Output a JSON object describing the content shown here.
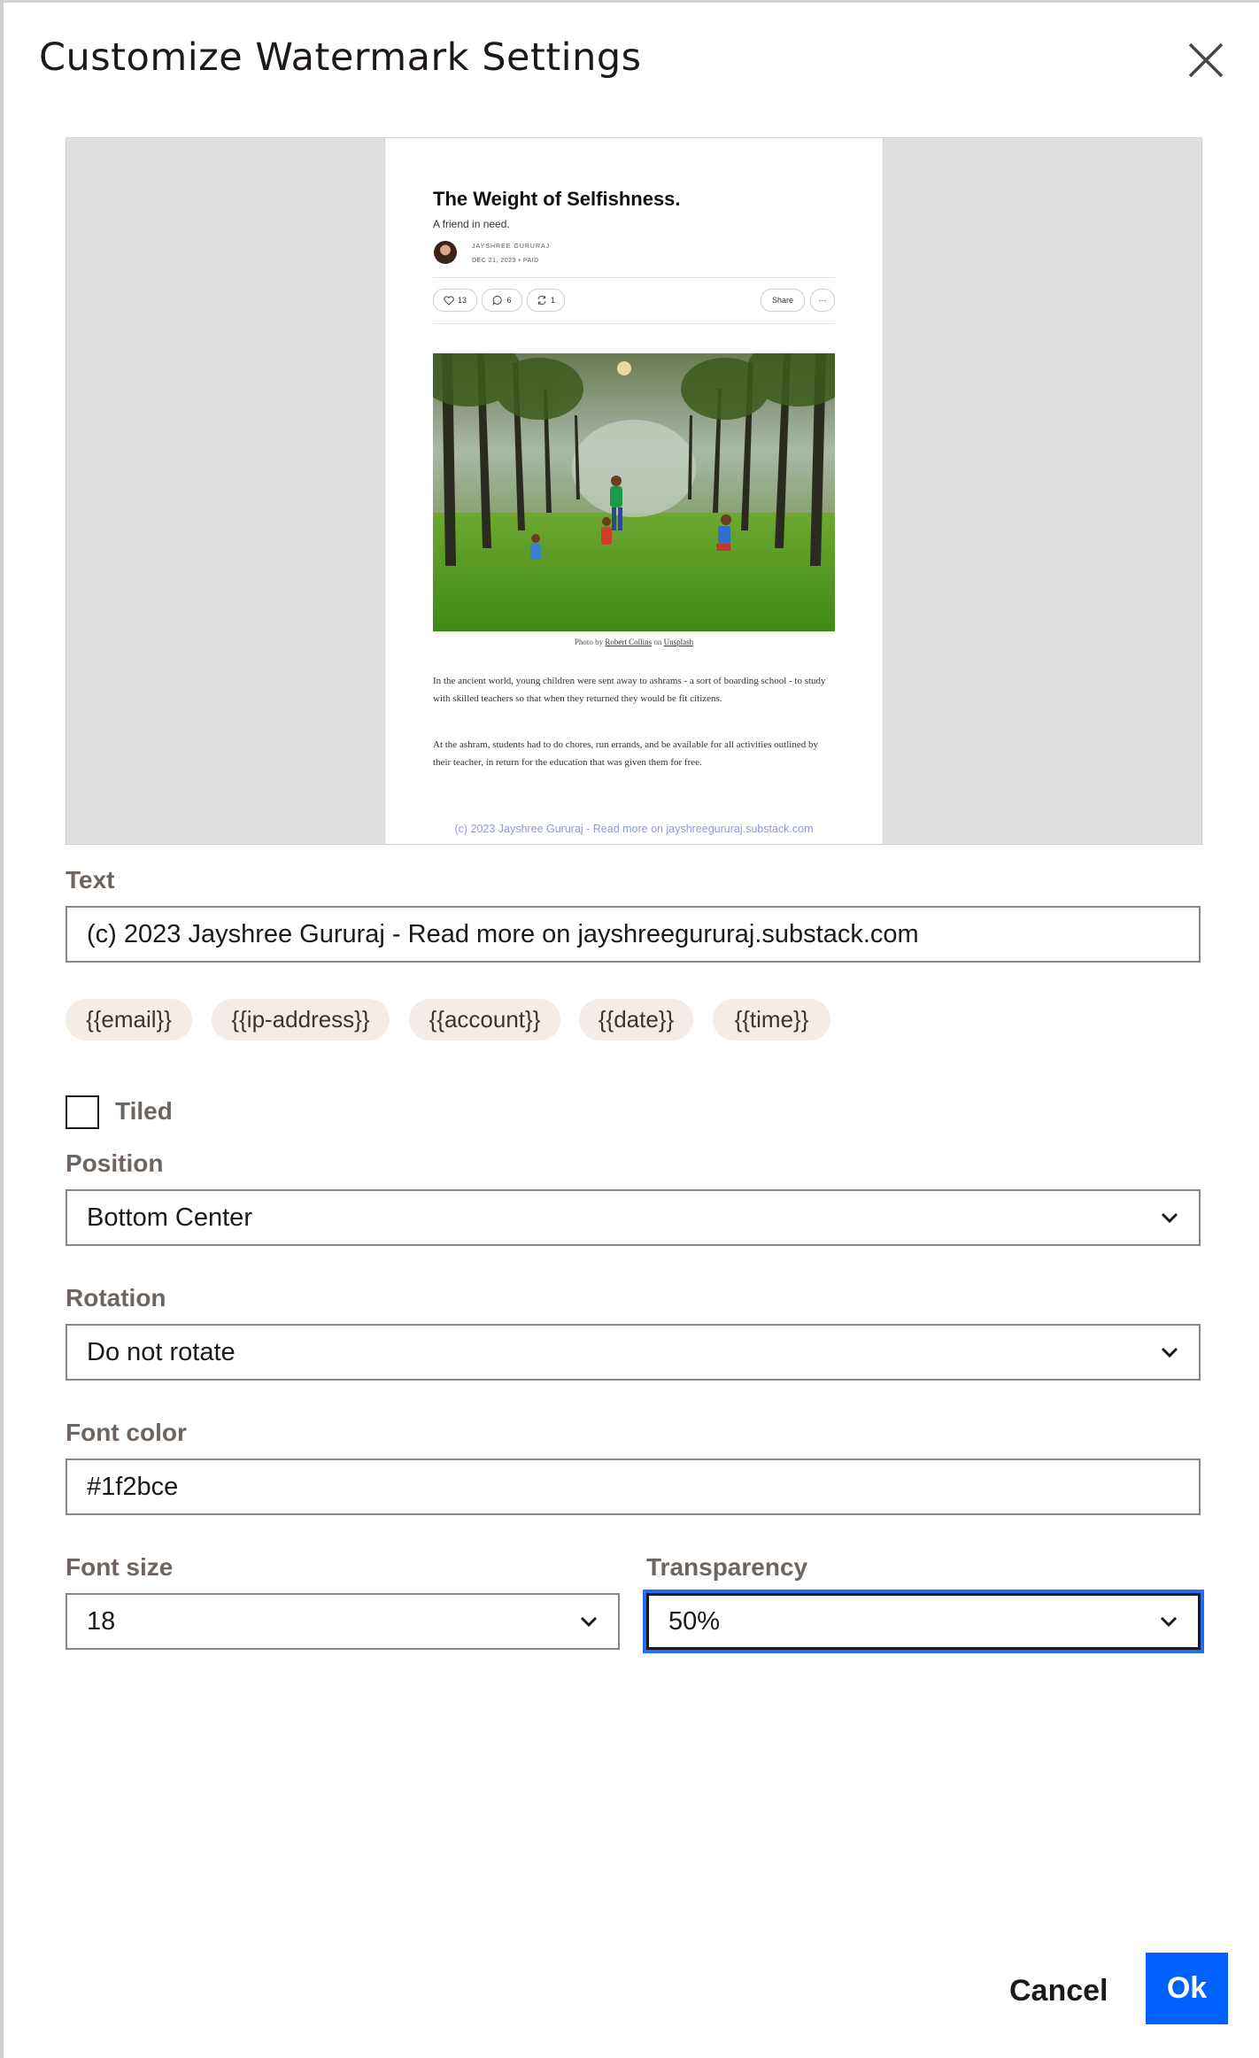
{
  "dialog": {
    "title": "Customize Watermark Settings",
    "close_icon": "close-icon"
  },
  "preview": {
    "doc_title": "The Weight of Selfishness.",
    "doc_subtitle": "A friend in need.",
    "author": "JAYSHREE GURURAJ",
    "date": "DEC 21, 2023 • PAID",
    "likes": "13",
    "comments": "6",
    "restacks": "1",
    "share_label": "Share",
    "more_label": "···",
    "caption_prefix": "Photo by ",
    "caption_author": "Robert Collins",
    "caption_mid": " on ",
    "caption_site": "Unsplash",
    "paragraph1": "In the ancient world, young children were sent away to ashrams - a sort of boarding school - to study with skilled teachers so that when they returned they would be fit citizens.",
    "paragraph2": "At the ashram, students had to do chores, run errands, and be available for all activities outlined by their teacher, in return for the education that was given them for free.",
    "watermark_text": "(c) 2023 Jayshree Gururaj - Read more on jayshreegururaj.substack.com"
  },
  "form": {
    "text_label": "Text",
    "text_value": "(c) 2023 Jayshree Gururaj - Read more on jayshreegururaj.substack.com",
    "chips": [
      "{{email}}",
      "{{ip-address}}",
      "{{account}}",
      "{{date}}",
      "{{time}}"
    ],
    "tiled_label": "Tiled",
    "tiled_checked": false,
    "position_label": "Position",
    "position_value": "Bottom Center",
    "rotation_label": "Rotation",
    "rotation_value": "Do not rotate",
    "font_color_label": "Font color",
    "font_color_value": "#1f2bce",
    "font_size_label": "Font size",
    "font_size_value": "18",
    "transparency_label": "Transparency",
    "transparency_value": "50%"
  },
  "footer": {
    "cancel_label": "Cancel",
    "ok_label": "Ok"
  },
  "colors": {
    "primary_button": "#0061fe",
    "focus_ring": "#1e6ff5",
    "watermark": "#1f2bce",
    "chip_bg": "#f4ede6",
    "label": "#6f6560"
  }
}
